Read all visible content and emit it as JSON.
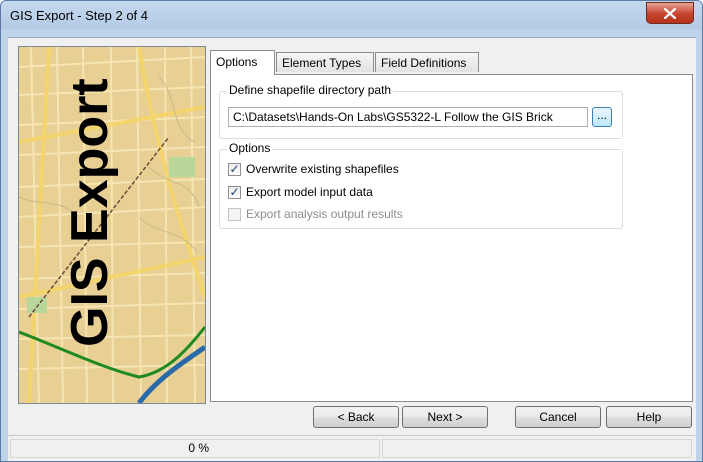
{
  "window": {
    "title": "GIS Export - Step 2 of 4",
    "close_glyph": "✕"
  },
  "side_panel": {
    "banner_text": "GIS Export"
  },
  "tabs": [
    {
      "label": "Options",
      "active": true
    },
    {
      "label": "Element Types",
      "active": false
    },
    {
      "label": "Field Definitions",
      "active": false
    }
  ],
  "path_group": {
    "legend": "Define shapefile directory path",
    "path_value": "C:\\Datasets\\Hands-On Labs\\GS5322-L Follow the GIS Brick",
    "browse_label": "..."
  },
  "options_group": {
    "legend": "Options",
    "items": [
      {
        "label": "Overwrite existing shapefiles",
        "checked": true,
        "enabled": true
      },
      {
        "label": "Export model input data",
        "checked": true,
        "enabled": true
      },
      {
        "label": "Export analysis output results",
        "checked": false,
        "enabled": false
      }
    ]
  },
  "buttons": {
    "back": "< Back",
    "next": "Next >",
    "cancel": "Cancel",
    "help": "Help"
  },
  "status": {
    "progress_text": "0 %"
  },
  "colors": {
    "title_bar": "#bfd4ea",
    "close_button": "#c6422c",
    "map_background": "#e8cf93",
    "map_road": "#f6e7b5",
    "map_river": "#2b6aa8",
    "map_trail": "#1f8a1f"
  }
}
